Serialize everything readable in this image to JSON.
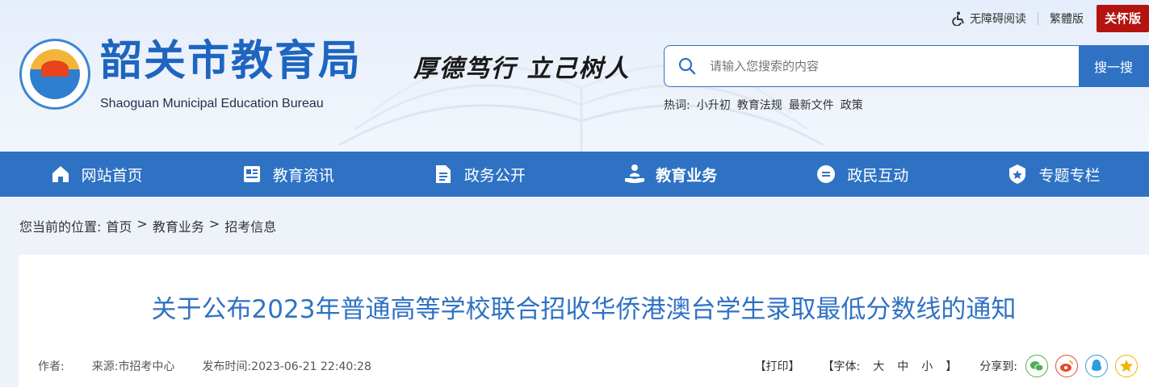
{
  "topbar": {
    "accessibility": "无障碍阅读",
    "traditional": "繁體版",
    "care_mode": "关怀版"
  },
  "site": {
    "title": "韶关市教育局",
    "subtitle": "Shaoguan Municipal Education Bureau",
    "motto": "厚德笃行  立己树人"
  },
  "search": {
    "placeholder": "请输入您搜索的内容",
    "button": "搜一搜",
    "hot_label": "热词:",
    "hot_words": [
      "小升初",
      "教育法规",
      "最新文件",
      "政策"
    ]
  },
  "nav": {
    "items": [
      {
        "label": "网站首页"
      },
      {
        "label": "教育资讯"
      },
      {
        "label": "政务公开"
      },
      {
        "label": "教育业务"
      },
      {
        "label": "政民互动"
      },
      {
        "label": "专题专栏"
      }
    ]
  },
  "breadcrumb": {
    "prefix": "您当前的位置:",
    "items": [
      "首页",
      "教育业务",
      "招考信息"
    ],
    "separator": ">"
  },
  "article": {
    "title": "关于公布2023年普通高等学校联合招收华侨港澳台学生录取最低分数线的通知",
    "author_label": "作者:",
    "source_label": "来源:",
    "source": "市招考中心",
    "published_label": "发布时间:",
    "published": "2023-06-21 22:40:28",
    "print": "【打印】",
    "font_label": "【字体:",
    "font_large": "大",
    "font_medium": "中",
    "font_small": "小",
    "font_close": "】",
    "share_label": "分享到:"
  },
  "colors": {
    "brand_blue": "#2f72c4",
    "care_red": "#b3140f"
  }
}
